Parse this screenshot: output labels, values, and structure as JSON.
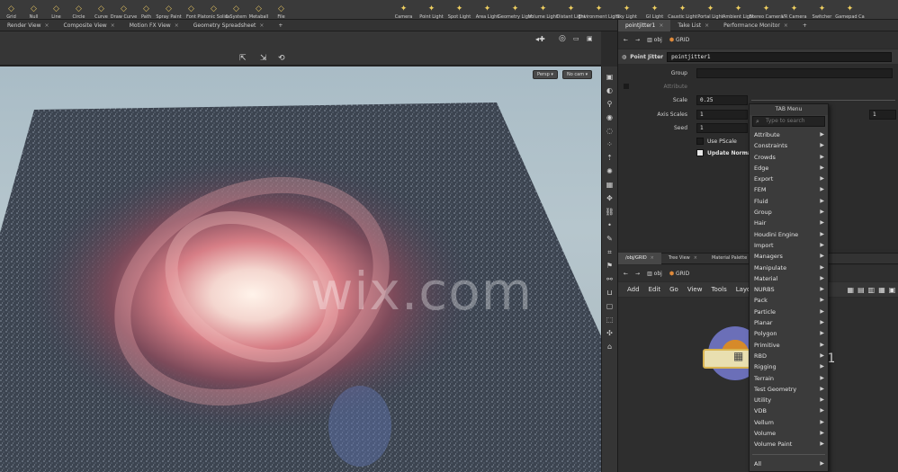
{
  "shelf": {
    "left_tools": [
      {
        "label": "Grid",
        "icon": "grid-icon"
      },
      {
        "label": "Null",
        "icon": "null-icon"
      },
      {
        "label": "Line",
        "icon": "line-icon"
      },
      {
        "label": "Circle",
        "icon": "circle-icon"
      },
      {
        "label": "Curve",
        "icon": "curve-icon"
      },
      {
        "label": "Draw Curve",
        "icon": "draw-curve-icon"
      },
      {
        "label": "Path",
        "icon": "path-icon"
      },
      {
        "label": "Spray Paint",
        "icon": "spray-paint-icon"
      },
      {
        "label": "Font",
        "icon": "font-icon"
      },
      {
        "label": "Platonic Solids",
        "icon": "platonic-icon"
      },
      {
        "label": "L-System",
        "icon": "lsystem-icon"
      },
      {
        "label": "Metaball",
        "icon": "metaball-icon"
      },
      {
        "label": "File",
        "icon": "file-icon"
      }
    ],
    "light_tools": [
      {
        "label": "Camera",
        "icon": "camera-icon"
      },
      {
        "label": "Point Light",
        "icon": "point-light-icon"
      },
      {
        "label": "Spot Light",
        "icon": "spot-light-icon"
      },
      {
        "label": "Area Light",
        "icon": "area-light-icon"
      },
      {
        "label": "Geometry Light",
        "icon": "geometry-light-icon"
      },
      {
        "label": "Volume Light",
        "icon": "volume-light-icon"
      },
      {
        "label": "Distant Light",
        "icon": "distant-light-icon"
      },
      {
        "label": "Environment Light",
        "icon": "environment-light-icon"
      },
      {
        "label": "Sky Light",
        "icon": "sky-light-icon"
      },
      {
        "label": "GI Light",
        "icon": "gi-light-icon"
      },
      {
        "label": "Caustic Light",
        "icon": "caustic-light-icon"
      },
      {
        "label": "Portal Light",
        "icon": "portal-light-icon"
      },
      {
        "label": "Ambient Light",
        "icon": "ambient-light-icon"
      },
      {
        "label": "Stereo Camera",
        "icon": "stereo-camera-icon"
      },
      {
        "label": "VR Camera",
        "icon": "vr-camera-icon"
      },
      {
        "label": "Switcher",
        "icon": "switcher-icon"
      },
      {
        "label": "Gamepad Ca",
        "icon": "gamepad-icon"
      }
    ]
  },
  "viewport_tabs": [
    "Render View",
    "Composite View",
    "Motion FX View",
    "Geometry Spreadsheet"
  ],
  "viewport": {
    "persp_label": "Persp",
    "cam_label": "No cam"
  },
  "param_tabs": [
    "pointjitter1",
    "Take List",
    "Performance Monitor"
  ],
  "param_path": {
    "context": "obj",
    "node": "GRID"
  },
  "param_header": {
    "type": "Point Jitter",
    "name": "pointjitter1"
  },
  "params": {
    "group_label": "Group",
    "attribute_label": "Attribute",
    "scale_label": "Scale",
    "scale_value": "0.25",
    "axis_scales_label": "Axis Scales",
    "axis_scales_values": [
      "1",
      "1",
      "1"
    ],
    "seed_label": "Seed",
    "seed_value": "1",
    "use_pscale_label": "Use PScale",
    "update_normals_label": "Update Normals"
  },
  "network_tabs": [
    "/obj/GRID",
    "Tree View",
    "Material Palette"
  ],
  "network_path": {
    "context": "obj",
    "node": "GRID"
  },
  "network_menu": [
    "Add",
    "Edit",
    "Go",
    "View",
    "Tools",
    "Layout"
  ],
  "network": {
    "node_label": "pointjitter1",
    "visible_label": "er1"
  },
  "tab_menu": {
    "title": "TAB Menu",
    "search_placeholder": "Type to search",
    "items": [
      "Attribute",
      "Constraints",
      "Crowds",
      "Edge",
      "Export",
      "FEM",
      "Fluid",
      "Group",
      "Hair",
      "Houdini Engine",
      "Import",
      "Managers",
      "Manipulate",
      "Material",
      "NURBS",
      "Pack",
      "Particle",
      "Planar",
      "Polygon",
      "Primitive",
      "RBD",
      "Rigging",
      "Terrain",
      "Test Geometry",
      "Utility",
      "VDB",
      "Vellum",
      "Volume",
      "Volume Paint"
    ],
    "footer_item": "All"
  },
  "watermark": "wix.com",
  "colors": {
    "accent": "#d9b451",
    "node_ring_outer": "#4a5ab0",
    "viewport_bg": "#b0c2ca"
  }
}
